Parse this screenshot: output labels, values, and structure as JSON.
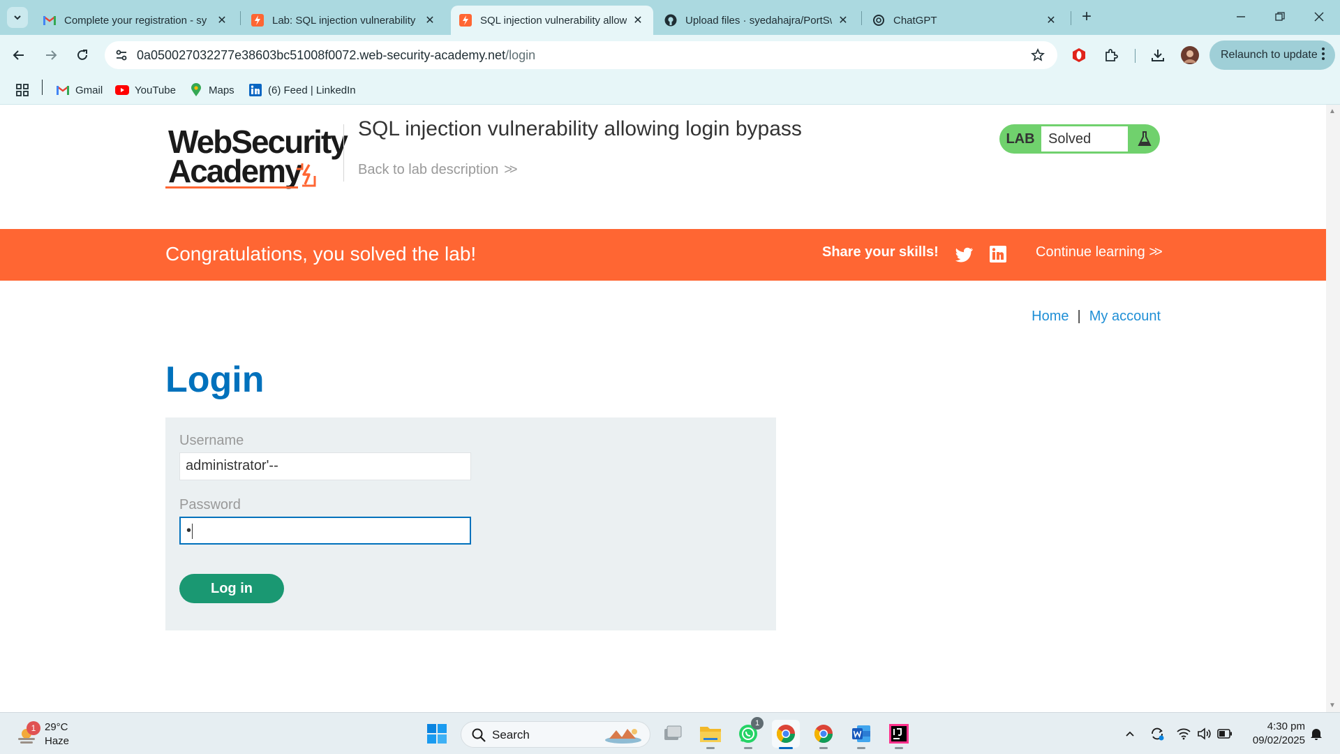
{
  "browser": {
    "tabs": [
      {
        "title": "Complete your registration - sy",
        "favicon": "gmail-icon",
        "active": false
      },
      {
        "title": "Lab: SQL injection vulnerability",
        "favicon": "portswigger-icon",
        "active": false
      },
      {
        "title": "SQL injection vulnerability allow",
        "favicon": "portswigger-icon",
        "active": true
      },
      {
        "title": "Upload files · syedahajra/PortSw",
        "favicon": "github-icon",
        "active": false
      },
      {
        "title": "ChatGPT",
        "favicon": "chatgpt-icon",
        "active": false
      }
    ],
    "close_glyph": "✕",
    "new_tab_glyph": "+",
    "url_host": "0a050027032277e38603bc51008f0072.web-security-academy.net",
    "url_path": "/login",
    "relaunch_label": "Relaunch to update",
    "bookmarks": [
      {
        "label": "Gmail",
        "icon": "gmail-icon"
      },
      {
        "label": "YouTube",
        "icon": "youtube-icon"
      },
      {
        "label": "Maps",
        "icon": "maps-icon"
      },
      {
        "label": "(6) Feed | LinkedIn",
        "icon": "linkedin-icon"
      }
    ]
  },
  "header": {
    "logo_line1": "WebSecurity",
    "logo_line2": "Academy",
    "lab_title": "SQL injection vulnerability allowing login bypass",
    "back_link": "Back to lab description",
    "badge_lab": "LAB",
    "badge_status": "Solved"
  },
  "banner": {
    "congrats": "Congratulations, you solved the lab!",
    "share": "Share your skills!",
    "continue": "Continue learning"
  },
  "nav": {
    "home": "Home",
    "separator": "|",
    "my_account": "My account"
  },
  "login": {
    "heading": "Login",
    "username_label": "Username",
    "username_value": "administrator'--",
    "password_label": "Password",
    "password_value": "•",
    "submit_label": "Log in"
  },
  "taskbar": {
    "weather_temp": "29°C",
    "weather_cond": "Haze",
    "weather_badge": "1",
    "search_label": "Search",
    "whatsapp_badge": "1",
    "time": "4:30 pm",
    "date": "09/02/2025"
  },
  "colors": {
    "accent_orange": "#ff6633",
    "link_blue": "#0071bc",
    "lab_green": "#70d16d",
    "button_green": "#1a9872"
  }
}
